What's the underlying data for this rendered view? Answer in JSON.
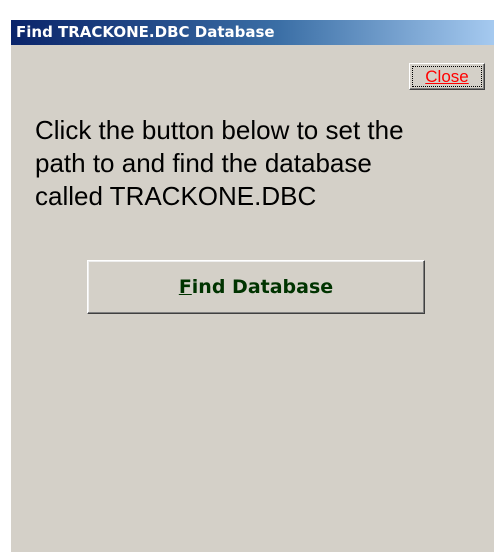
{
  "window": {
    "title": "Find TRACKONE.DBC Database"
  },
  "close_button": {
    "label": "Close",
    "color": "#ff0000"
  },
  "message": {
    "line1": "Click the button below to set the",
    "line2": "path to and find the database",
    "line3": "called TRACKONE.DBC"
  },
  "find_button": {
    "accelerator": "F",
    "label_rest": "ind Database",
    "color": "#003300"
  },
  "colors": {
    "title_bar_start": "#0a246a",
    "title_bar_end": "#a6caf0",
    "window_background": "#d4d0c8"
  }
}
